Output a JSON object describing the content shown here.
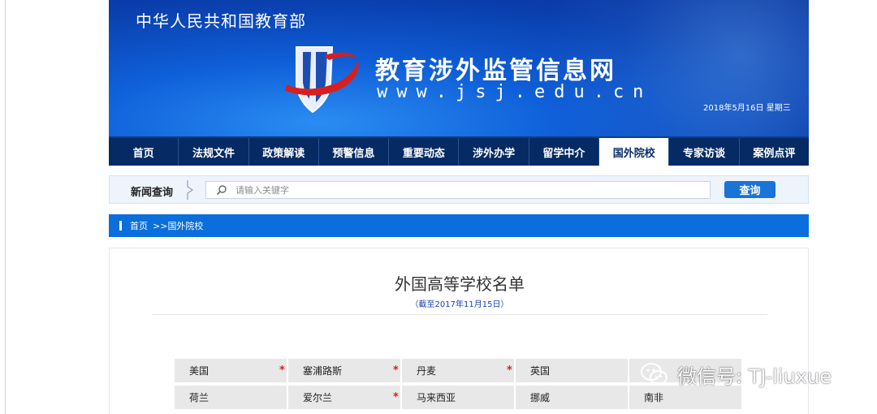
{
  "header": {
    "ministry": "中华人民共和国教育部",
    "site_name": "教育涉外监管信息网",
    "site_url": "www.jsj.edu.cn",
    "date": "2018年5月16日 星期三",
    "logo_icon": "jsj-shield-logo-icon"
  },
  "nav": {
    "items": [
      {
        "label": "首页"
      },
      {
        "label": "法规文件"
      },
      {
        "label": "政策解读"
      },
      {
        "label": "预警信息"
      },
      {
        "label": "重要动态"
      },
      {
        "label": "涉外办学"
      },
      {
        "label": "留学中介"
      },
      {
        "label": "国外院校",
        "active": true
      },
      {
        "label": "专家访谈"
      },
      {
        "label": "案例点评"
      }
    ]
  },
  "search": {
    "label": "新闻查询",
    "placeholder": "请输入关键字",
    "value": "",
    "button": "查询",
    "icon": "search-icon"
  },
  "breadcrumb": {
    "home": "首页",
    "separator": ">>",
    "current": "国外院校"
  },
  "content": {
    "title": "外国高等学校名单",
    "subtitle": "（截至2017年11月15日）",
    "countries": [
      [
        {
          "name": "美国",
          "star": false
        },
        {
          "name": "塞浦路斯",
          "star": true
        },
        {
          "name": "丹麦",
          "star": true
        },
        {
          "name": "英国",
          "star": true
        },
        {
          "name": "",
          "star": false
        }
      ],
      [
        {
          "name": "荷兰",
          "star": false
        },
        {
          "name": "爱尔兰",
          "star": false
        },
        {
          "name": "马来西亚",
          "star": true
        },
        {
          "name": "挪威",
          "star": false
        },
        {
          "name": "南非",
          "star": false
        }
      ]
    ],
    "star_symbol": "*"
  },
  "watermark": {
    "text": "微信号: TJ-liuxue",
    "icon": "wechat-icon"
  },
  "colors": {
    "nav_bg": "#062a63",
    "breadcrumb_bg": "#0a6fdc",
    "button_bg": "#1a73d6",
    "star": "#e01b1b",
    "subtitle": "#1a3fb8"
  }
}
